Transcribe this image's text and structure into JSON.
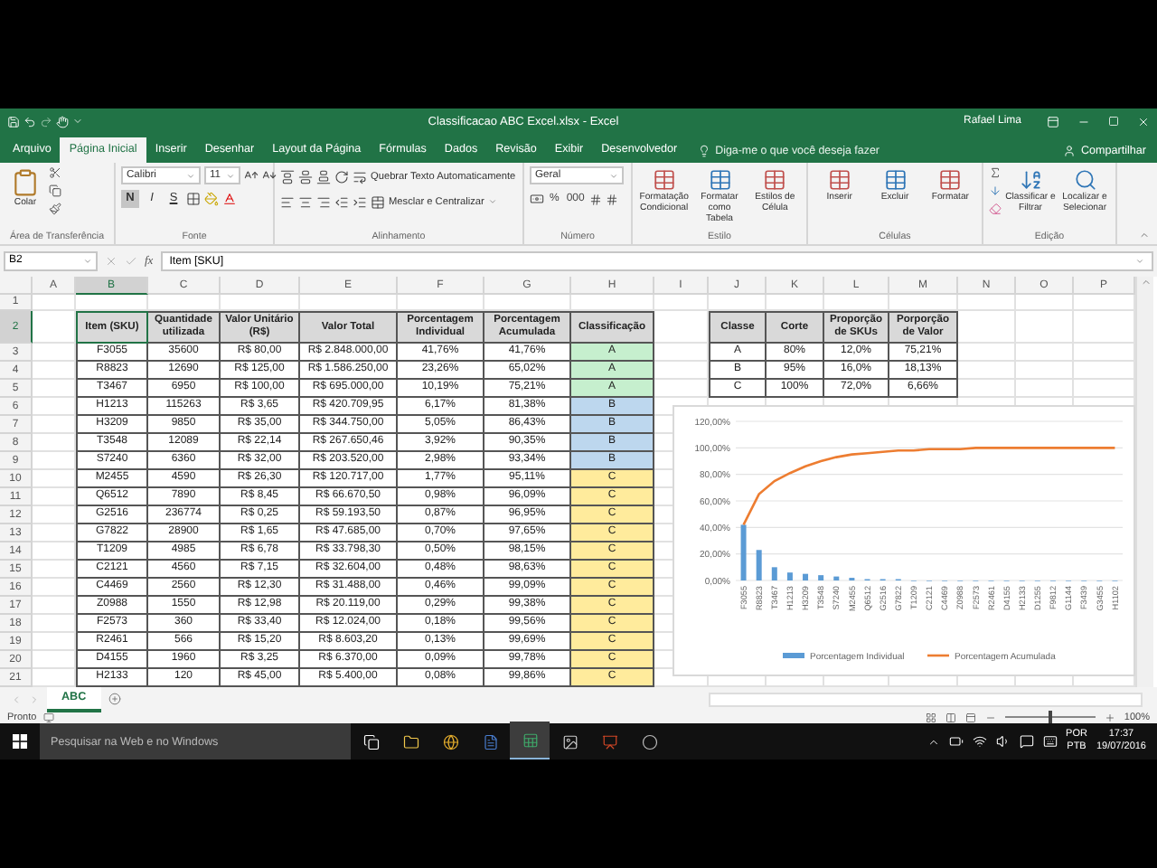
{
  "window": {
    "title": "Classificacao ABC Excel.xlsx - Excel",
    "user": "Rafael Lima"
  },
  "menu_tabs": [
    {
      "label": "Arquivo",
      "selected": false
    },
    {
      "label": "Página Inicial",
      "selected": true
    },
    {
      "label": "Inserir",
      "selected": false
    },
    {
      "label": "Desenhar",
      "selected": false
    },
    {
      "label": "Layout da Página",
      "selected": false
    },
    {
      "label": "Fórmulas",
      "selected": false
    },
    {
      "label": "Dados",
      "selected": false
    },
    {
      "label": "Revisão",
      "selected": false
    },
    {
      "label": "Exibir",
      "selected": false
    },
    {
      "label": "Desenvolvedor",
      "selected": false
    }
  ],
  "tell_me": {
    "placeholder": "Diga-me o que você deseja fazer"
  },
  "share": "Compartilhar",
  "ribbon": [
    {
      "kind": "clipboard",
      "label": "Área de Transferência",
      "paste": "Colar"
    },
    {
      "kind": "font",
      "label": "Fonte",
      "font_name": "Calibri",
      "font_size": "11",
      "toggles": [
        {
          "label": "N",
          "kind": "bold",
          "selected": true
        },
        {
          "label": "I",
          "kind": "italic",
          "selected": false
        },
        {
          "label": "S",
          "kind": "underline",
          "selected": false
        }
      ]
    },
    {
      "kind": "alignment",
      "label": "Alinhamento",
      "wrap": "Quebrar Texto Automaticamente",
      "merge": "Mesclar e Centralizar"
    },
    {
      "kind": "number",
      "label": "Número",
      "format": "Geral",
      "buttons": [
        "%",
        "000"
      ]
    },
    {
      "kind": "commands",
      "label": "Estilo",
      "commands": [
        "Formatação Condicional",
        "Formatar como Tabela",
        "Estilos de Célula"
      ]
    },
    {
      "kind": "commands",
      "label": "Células",
      "commands": [
        "Inserir",
        "Excluir",
        "Formatar"
      ]
    },
    {
      "kind": "editing",
      "label": "Edição",
      "commands": [
        "Classificar e Filtrar",
        "Localizar e Selecionar"
      ]
    }
  ],
  "formula_bar": {
    "name_box": "B2",
    "function_label": "fx",
    "value": "Item [SKU]"
  },
  "sheet": {
    "columns": [
      {
        "label": "A",
        "selected": false
      },
      {
        "label": "B",
        "selected": true
      },
      {
        "label": "C",
        "selected": false
      },
      {
        "label": "D",
        "selected": false
      },
      {
        "label": "E",
        "selected": false
      },
      {
        "label": "F",
        "selected": false
      },
      {
        "label": "G",
        "selected": false
      },
      {
        "label": "H",
        "selected": false
      },
      {
        "label": "I",
        "selected": false
      },
      {
        "label": "J",
        "selected": false
      },
      {
        "label": "K",
        "selected": false
      },
      {
        "label": "L",
        "selected": false
      },
      {
        "label": "M",
        "selected": false
      },
      {
        "label": "N",
        "selected": false
      },
      {
        "label": "O",
        "selected": false
      },
      {
        "label": "P",
        "selected": false
      }
    ],
    "rows": [
      {
        "label": "1",
        "selected": false
      },
      {
        "label": "2",
        "selected": true
      },
      {
        "label": "3",
        "selected": false
      },
      {
        "label": "4",
        "selected": false
      },
      {
        "label": "5",
        "selected": false
      },
      {
        "label": "6",
        "selected": false
      },
      {
        "label": "7",
        "selected": false
      },
      {
        "label": "8",
        "selected": false
      },
      {
        "label": "9",
        "selected": false
      },
      {
        "label": "10",
        "selected": false
      },
      {
        "label": "11",
        "selected": false
      },
      {
        "label": "12",
        "selected": false
      },
      {
        "label": "13",
        "selected": false
      },
      {
        "label": "14",
        "selected": false
      },
      {
        "label": "15",
        "selected": false
      },
      {
        "label": "16",
        "selected": false
      },
      {
        "label": "17",
        "selected": false
      },
      {
        "label": "18",
        "selected": false
      },
      {
        "label": "19",
        "selected": false
      },
      {
        "label": "20",
        "selected": false
      },
      {
        "label": "21",
        "selected": false
      }
    ],
    "table": {
      "headers": [
        "Item (SKU)",
        "Quantidade utilizada",
        "Valor Unitário (R$)",
        "Valor Total",
        "Porcentagem Individual",
        "Porcentagem Acumulada",
        "Classificação"
      ],
      "rows": [
        {
          "cells": [
            "F3055",
            "35600",
            "R$ 80,00",
            "R$ 2.848.000,00",
            "41,76%",
            "41,76%",
            "A"
          ],
          "color": "#c6efce"
        },
        {
          "cells": [
            "R8823",
            "12690",
            "R$ 125,00",
            "R$ 1.586.250,00",
            "23,26%",
            "65,02%",
            "A"
          ],
          "color": "#c6efce"
        },
        {
          "cells": [
            "T3467",
            "6950",
            "R$ 100,00",
            "R$ 695.000,00",
            "10,19%",
            "75,21%",
            "A"
          ],
          "color": "#c6efce"
        },
        {
          "cells": [
            "H1213",
            "115263",
            "R$ 3,65",
            "R$ 420.709,95",
            "6,17%",
            "81,38%",
            "B"
          ],
          "color": "#bdd7ee"
        },
        {
          "cells": [
            "H3209",
            "9850",
            "R$ 35,00",
            "R$ 344.750,00",
            "5,05%",
            "86,43%",
            "B"
          ],
          "color": "#bdd7ee"
        },
        {
          "cells": [
            "T3548",
            "12089",
            "R$ 22,14",
            "R$ 267.650,46",
            "3,92%",
            "90,35%",
            "B"
          ],
          "color": "#bdd7ee"
        },
        {
          "cells": [
            "S7240",
            "6360",
            "R$ 32,00",
            "R$ 203.520,00",
            "2,98%",
            "93,34%",
            "B"
          ],
          "color": "#bdd7ee"
        },
        {
          "cells": [
            "M2455",
            "4590",
            "R$ 26,30",
            "R$ 120.717,00",
            "1,77%",
            "95,11%",
            "C"
          ],
          "color": "#ffeb9c"
        },
        {
          "cells": [
            "Q6512",
            "7890",
            "R$ 8,45",
            "R$ 66.670,50",
            "0,98%",
            "96,09%",
            "C"
          ],
          "color": "#ffeb9c"
        },
        {
          "cells": [
            "G2516",
            "236774",
            "R$ 0,25",
            "R$ 59.193,50",
            "0,87%",
            "96,95%",
            "C"
          ],
          "color": "#ffeb9c"
        },
        {
          "cells": [
            "G7822",
            "28900",
            "R$ 1,65",
            "R$ 47.685,00",
            "0,70%",
            "97,65%",
            "C"
          ],
          "color": "#ffeb9c"
        },
        {
          "cells": [
            "T1209",
            "4985",
            "R$ 6,78",
            "R$ 33.798,30",
            "0,50%",
            "98,15%",
            "C"
          ],
          "color": "#ffeb9c"
        },
        {
          "cells": [
            "C2121",
            "4560",
            "R$ 7,15",
            "R$ 32.604,00",
            "0,48%",
            "98,63%",
            "C"
          ],
          "color": "#ffeb9c"
        },
        {
          "cells": [
            "C4469",
            "2560",
            "R$ 12,30",
            "R$ 31.488,00",
            "0,46%",
            "99,09%",
            "C"
          ],
          "color": "#ffeb9c"
        },
        {
          "cells": [
            "Z0988",
            "1550",
            "R$ 12,98",
            "R$ 20.119,00",
            "0,29%",
            "99,38%",
            "C"
          ],
          "color": "#ffeb9c"
        },
        {
          "cells": [
            "F2573",
            "360",
            "R$ 33,40",
            "R$ 12.024,00",
            "0,18%",
            "99,56%",
            "C"
          ],
          "color": "#ffeb9c"
        },
        {
          "cells": [
            "R2461",
            "566",
            "R$ 15,20",
            "R$ 8.603,20",
            "0,13%",
            "99,69%",
            "C"
          ],
          "color": "#ffeb9c"
        },
        {
          "cells": [
            "D4155",
            "1960",
            "R$ 3,25",
            "R$ 6.370,00",
            "0,09%",
            "99,78%",
            "C"
          ],
          "color": "#ffeb9c"
        },
        {
          "cells": [
            "H2133",
            "120",
            "R$ 45,00",
            "R$ 5.400,00",
            "0,08%",
            "99,86%",
            "C"
          ],
          "color": "#ffeb9c"
        }
      ]
    },
    "summary": {
      "headers": [
        "Classe",
        "Corte",
        "Proporção de SKUs",
        "Porporção de Valor"
      ],
      "rows": [
        [
          "A",
          "80%",
          "12,0%",
          "75,21%"
        ],
        [
          "B",
          "95%",
          "16,0%",
          "18,13%"
        ],
        [
          "C",
          "100%",
          "72,0%",
          "6,66%"
        ]
      ]
    },
    "chart": {
      "chart_data": {
        "type": "bar",
        "categories": [
          "F3055",
          "R8823",
          "T3467",
          "H1213",
          "H3209",
          "T3548",
          "S7240",
          "M2455",
          "Q6512",
          "G2516",
          "G7822",
          "T1209",
          "C2121",
          "C4469",
          "Z0988",
          "F2573",
          "R2461",
          "D4155",
          "H2133",
          "D1255",
          "F9812",
          "G1144",
          "F3439",
          "G3455",
          "H1102"
        ],
        "series": [
          {
            "name": "Porcentagem Individual",
            "type": "bar",
            "color": "#5b9bd5",
            "values": [
              42,
              23,
              10,
              6,
              5,
              4,
              3,
              2,
              1,
              1,
              1,
              0,
              0,
              0,
              0,
              0,
              0,
              0,
              0,
              0,
              0,
              0,
              0,
              0,
              0
            ]
          },
          {
            "name": "Porcentagem Acumulada",
            "type": "line",
            "color": "#ed7d31",
            "values": [
              42,
              65,
              75,
              81,
              86,
              90,
              93,
              95,
              96,
              97,
              98,
              98,
              99,
              99,
              99,
              100,
              100,
              100,
              100,
              100,
              100,
              100,
              100,
              100,
              100
            ]
          }
        ],
        "grid": true,
        "legend": true,
        "ylim": [
          0,
          120
        ],
        "yticks": [
          {
            "value": 0,
            "label": "0,00%"
          },
          {
            "value": 20,
            "label": "20,00%"
          },
          {
            "value": 40,
            "label": "40,00%"
          },
          {
            "value": 60,
            "label": "60,00%"
          },
          {
            "value": 80,
            "label": "80,00%"
          },
          {
            "value": 100,
            "label": "100,00%"
          },
          {
            "value": 120,
            "label": "120,00%"
          }
        ]
      }
    }
  },
  "sheet_tabs": [
    {
      "label": "ABC",
      "selected": true
    }
  ],
  "status_bar": {
    "text": "Pronto",
    "zoom_slider": {
      "level": 0.5
    },
    "zoom": "100%"
  },
  "taskbar": {
    "search_placeholder": "Pesquisar na Web e no Windows",
    "language": "POR",
    "layout": "PTB",
    "time": "17:37",
    "date": "19/07/2016"
  }
}
